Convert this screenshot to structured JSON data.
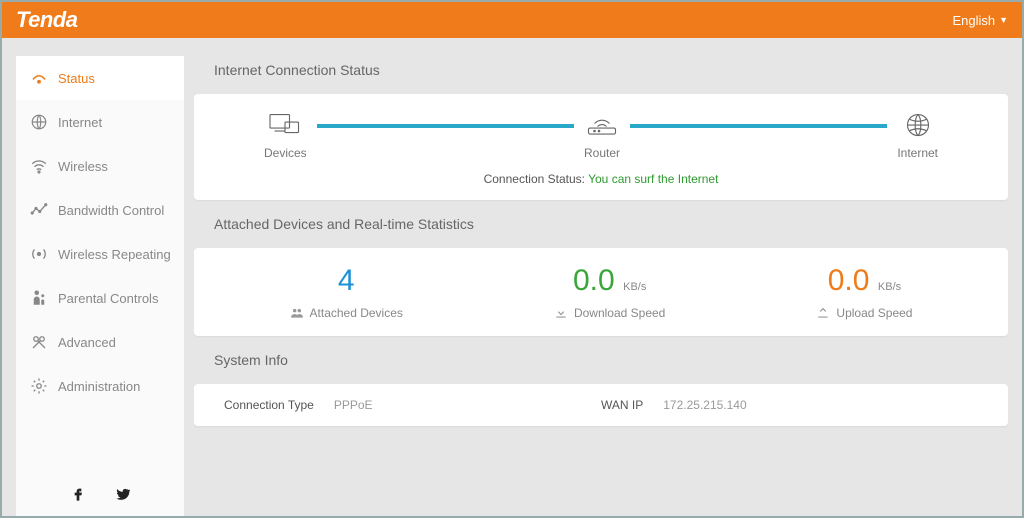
{
  "header": {
    "brand": "Tenda",
    "language": "English"
  },
  "sidebar": {
    "items": [
      {
        "label": "Status"
      },
      {
        "label": "Internet"
      },
      {
        "label": "Wireless"
      },
      {
        "label": "Bandwidth Control"
      },
      {
        "label": "Wireless Repeating"
      },
      {
        "label": "Parental Controls"
      },
      {
        "label": "Advanced"
      },
      {
        "label": "Administration"
      }
    ]
  },
  "sections": {
    "conn": {
      "title": "Internet Connection Status",
      "nodes": {
        "devices": "Devices",
        "router": "Router",
        "internet": "Internet"
      },
      "status_label": "Connection Status:",
      "status_value": "You can surf the Internet"
    },
    "stats": {
      "title": "Attached Devices and Real-time Statistics",
      "attached": {
        "value": "4",
        "label": "Attached Devices"
      },
      "download": {
        "value": "0.0",
        "unit": "KB/s",
        "label": "Download Speed"
      },
      "upload": {
        "value": "0.0",
        "unit": "KB/s",
        "label": "Upload Speed"
      }
    },
    "sys": {
      "title": "System Info",
      "conn_type_k": "Connection Type",
      "conn_type_v": "PPPoE",
      "wan_ip_k": "WAN IP",
      "wan_ip_v": "172.25.215.140"
    }
  }
}
